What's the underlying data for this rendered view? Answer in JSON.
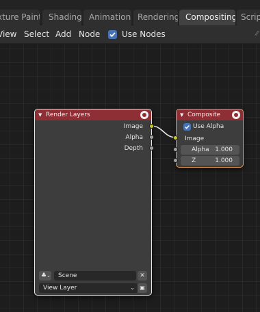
{
  "workspace_tabs": [
    {
      "label": "xture Paint",
      "active": false
    },
    {
      "label": "Shading",
      "active": false
    },
    {
      "label": "Animation",
      "active": false
    },
    {
      "label": "Rendering",
      "active": false
    },
    {
      "label": "Compositing",
      "active": true
    },
    {
      "label": "Script",
      "active": false
    }
  ],
  "header": {
    "view": "View",
    "select": "Select",
    "add": "Add",
    "node": "Node",
    "use_nodes_label": "Use Nodes",
    "use_nodes_checked": true
  },
  "render_layers_node": {
    "title": "Render Layers",
    "outputs": [
      "Image",
      "Alpha",
      "Depth"
    ],
    "scene_value": "Scene",
    "view_layer_value": "View Layer"
  },
  "composite_node": {
    "title": "Composite",
    "use_alpha_label": "Use Alpha",
    "use_alpha_checked": true,
    "inputs": {
      "image": "Image",
      "alpha_label": "Alpha",
      "alpha_value": "1.000",
      "z_label": "Z",
      "z_value": "1.000"
    }
  },
  "colors": {
    "accent": "#4772b3",
    "node_header": "#8e2e35",
    "image_socket": "#c7c729",
    "value_socket": "#a1a1a1"
  }
}
